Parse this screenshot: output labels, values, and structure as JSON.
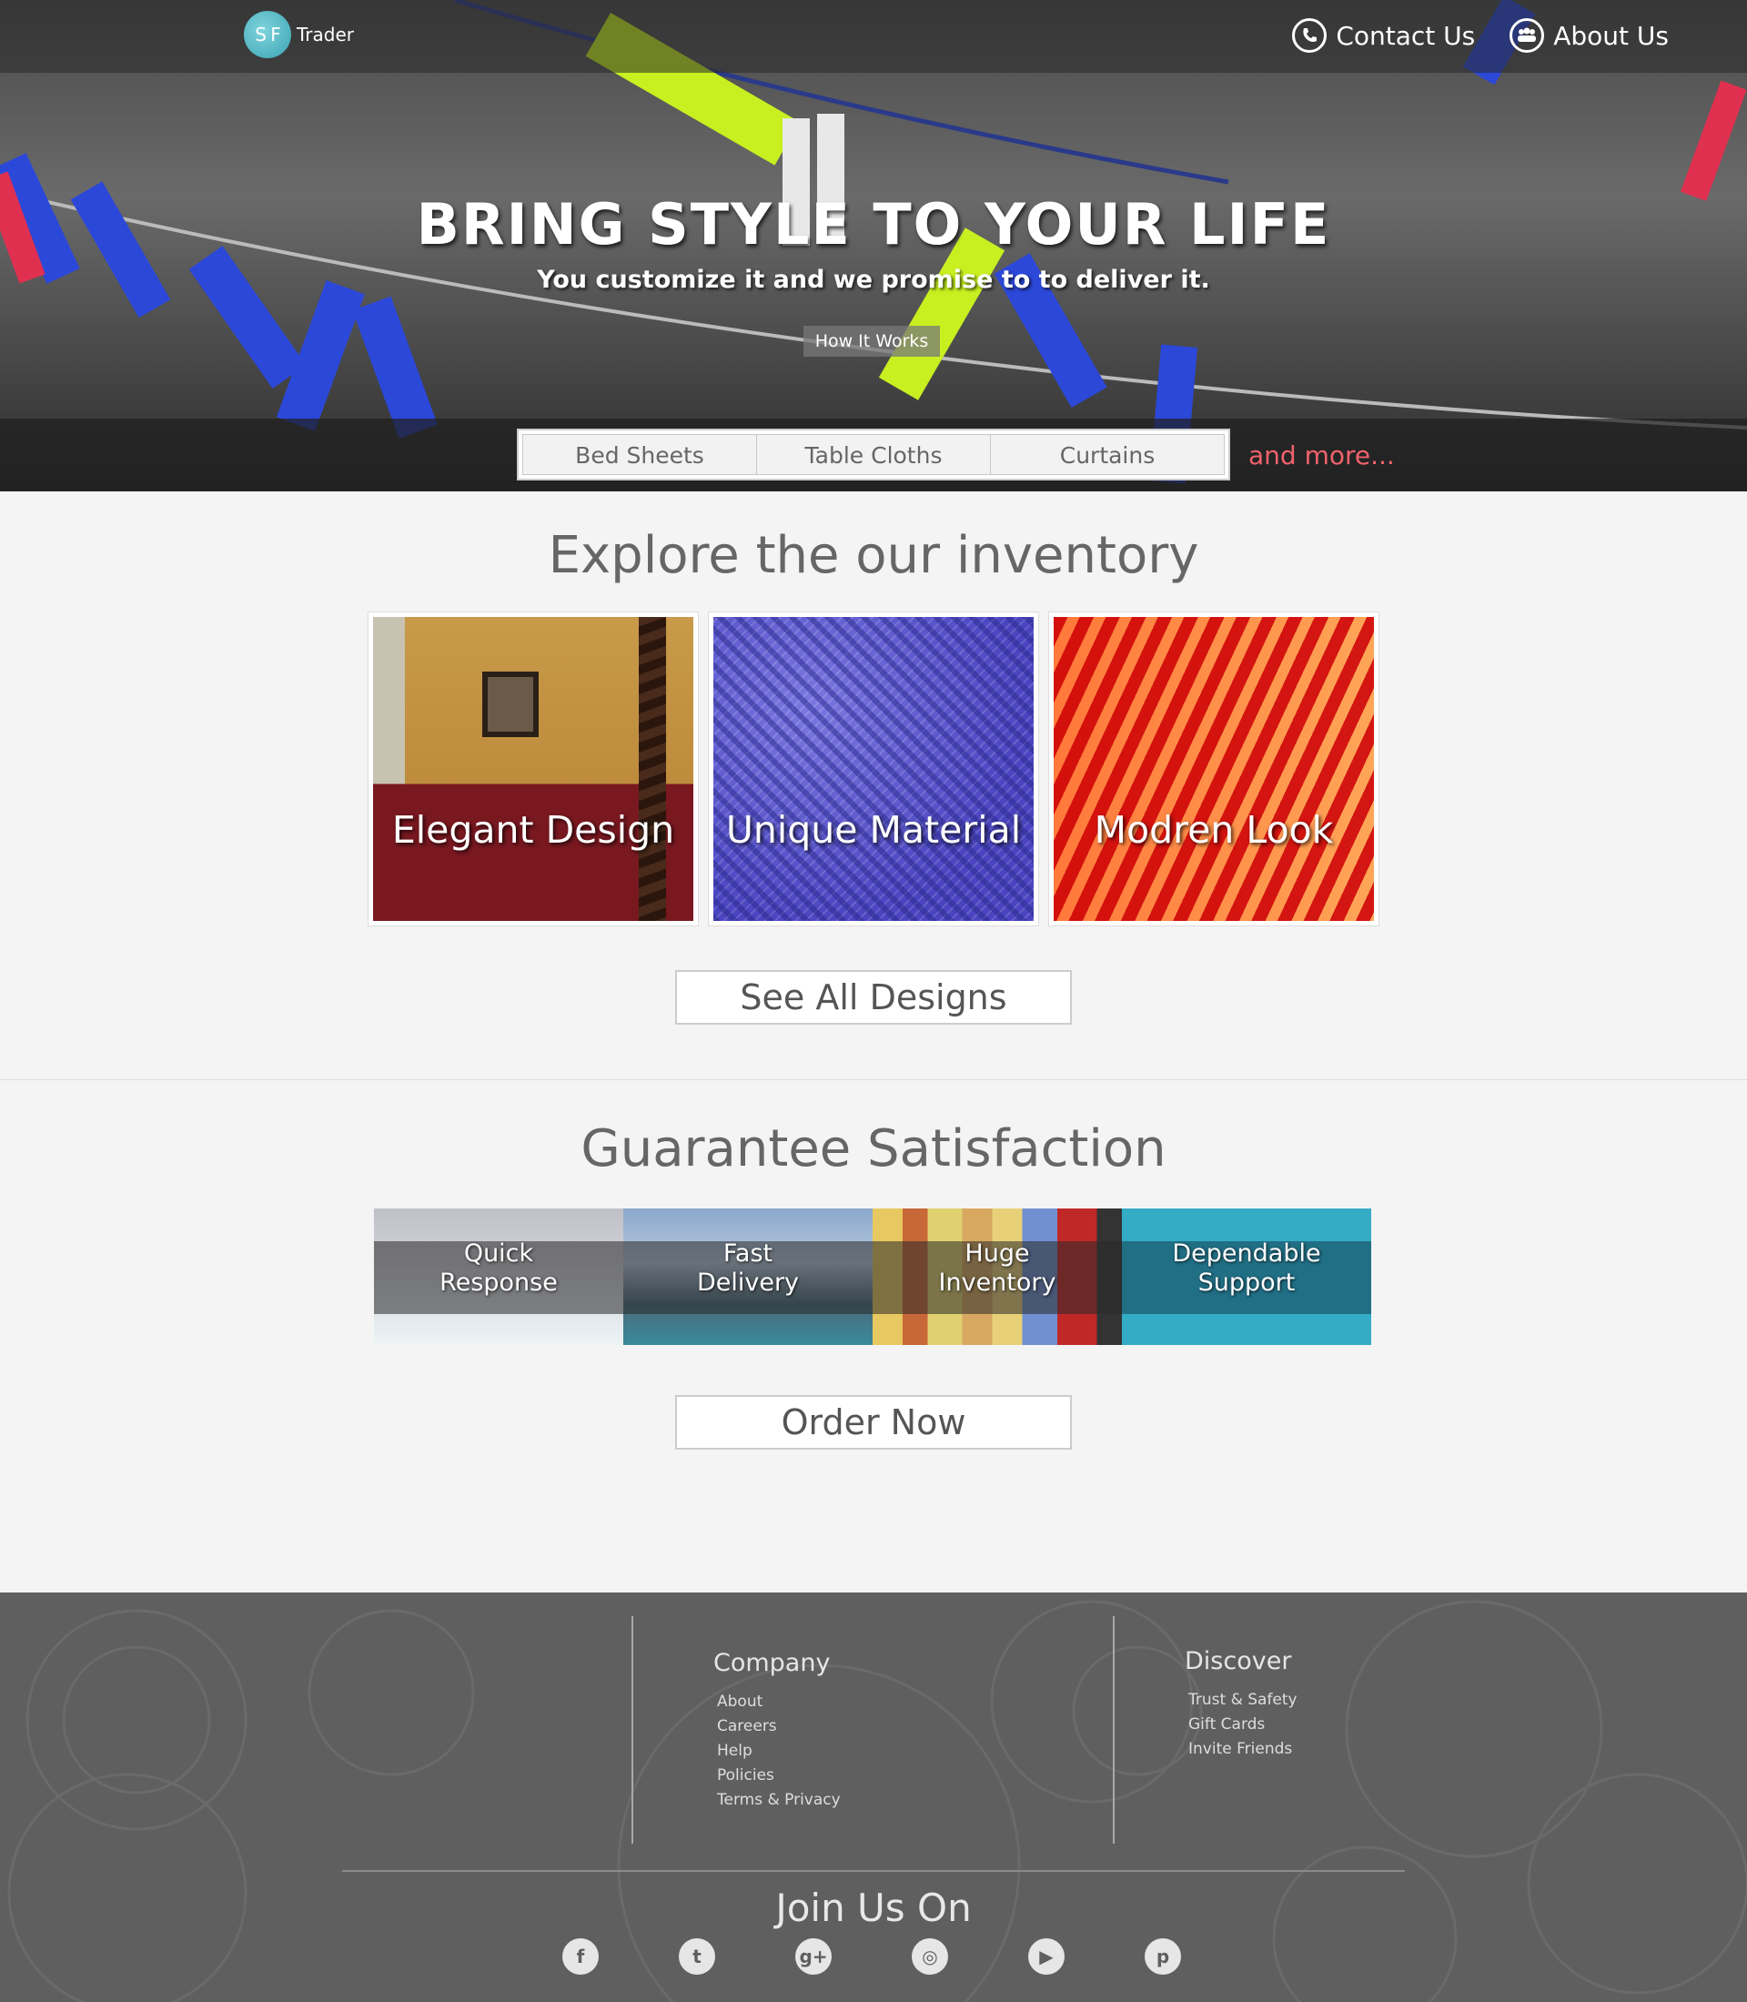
{
  "header": {
    "logo_badge": "S F",
    "logo_text": "Trader",
    "nav": [
      {
        "label": "Contact Us",
        "icon": "phone-icon"
      },
      {
        "label": "About Us",
        "icon": "people-icon"
      }
    ]
  },
  "hero": {
    "title": "BRING STYLE TO YOUR LIFE",
    "subtitle": "You customize it and we promise to to deliver it.",
    "cta_label": "How It Works"
  },
  "categories": {
    "items": [
      "Bed Sheets",
      "Table Cloths",
      "Curtains"
    ],
    "more_label": "and more...",
    "more_color": "#f0626b"
  },
  "inventory": {
    "title": "Explore the our inventory",
    "tiles": [
      {
        "label": "Elegant Design"
      },
      {
        "label": "Unique Material"
      },
      {
        "label": "Modren Look"
      }
    ],
    "button_label": "See All Designs"
  },
  "guarantee": {
    "title": "Guarantee Satisfaction",
    "features": [
      {
        "line1": "Quick",
        "line2": "Response"
      },
      {
        "line1": "Fast",
        "line2": "Delivery"
      },
      {
        "line1": "Huge",
        "line2": "Inventory"
      },
      {
        "line1": "Dependable",
        "line2": "Support"
      }
    ],
    "button_label": "Order Now"
  },
  "footer": {
    "company": {
      "title": "Company",
      "links": [
        "About",
        "Careers",
        "Help",
        "Policies",
        "Terms & Privacy"
      ]
    },
    "discover": {
      "title": "Discover",
      "links": [
        "Trust & Safety",
        "Gift Cards",
        "Invite Friends"
      ]
    },
    "join_title": "Join Us On",
    "socials": [
      {
        "icon": "facebook-icon",
        "glyph": "f"
      },
      {
        "icon": "twitter-icon",
        "glyph": "t"
      },
      {
        "icon": "google-plus-icon",
        "glyph": "g+"
      },
      {
        "icon": "instagram-icon",
        "glyph": "◎"
      },
      {
        "icon": "youtube-icon",
        "glyph": "▶"
      },
      {
        "icon": "pinterest-icon",
        "glyph": "p"
      }
    ]
  },
  "colors": {
    "accent_teal": "#35acc6",
    "footer_bg": "#5f5f5f",
    "page_bg": "#f4f4f4"
  }
}
